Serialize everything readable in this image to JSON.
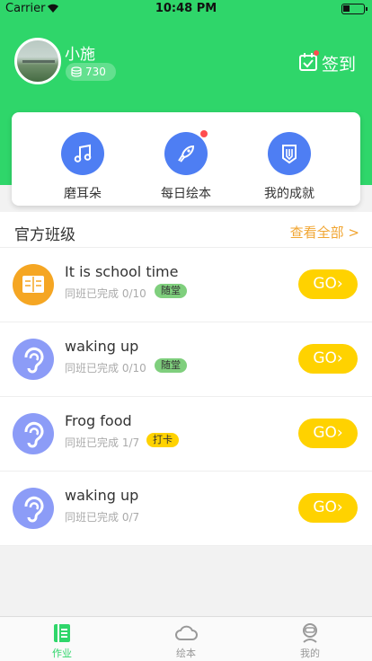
{
  "status_bar": {
    "carrier": "Carrier",
    "time": "10:48 PM"
  },
  "profile": {
    "name": "小施",
    "coins": "730",
    "checkin_label": "签到"
  },
  "features": [
    {
      "label": "磨耳朵",
      "icon": "music-note-icon"
    },
    {
      "label": "每日绘本",
      "icon": "rocket-icon"
    },
    {
      "label": "我的成就",
      "icon": "pencil-badge-icon"
    }
  ],
  "section": {
    "title": "官方班级",
    "view_all": "查看全部 >"
  },
  "classes": [
    {
      "name": "It is school time",
      "progress": "同班已完成 0/10",
      "tag": "随堂",
      "icon": "book-icon",
      "button": "GO"
    },
    {
      "name": "waking up",
      "progress": "同班已完成 0/10",
      "tag": "随堂",
      "icon": "ear-icon",
      "button": "GO"
    },
    {
      "name": "Frog food",
      "progress": "同班已完成 1/7",
      "tag": "打卡",
      "icon": "ear-icon",
      "button": "GO"
    },
    {
      "name": "waking up",
      "progress": "同班已完成 0/7",
      "tag": "",
      "icon": "ear-icon",
      "button": "GO"
    }
  ],
  "tabbar": [
    {
      "label": "作业",
      "active": true
    },
    {
      "label": "绘本",
      "active": false
    },
    {
      "label": "我的",
      "active": false
    }
  ],
  "colors": {
    "primary_green": "#2fd66a",
    "accent_yellow": "#ffd200",
    "accent_orange": "#f1a531",
    "feature_blue": "#4e7ef3"
  }
}
